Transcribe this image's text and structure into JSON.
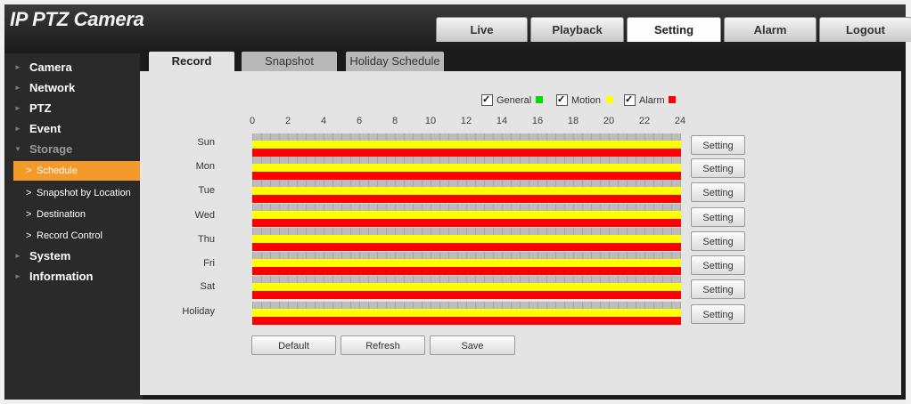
{
  "app": {
    "title": "IP PTZ Camera"
  },
  "top_tabs": [
    {
      "label": "Live"
    },
    {
      "label": "Playback"
    },
    {
      "label": "Setting",
      "active": true
    },
    {
      "label": "Alarm"
    },
    {
      "label": "Logout"
    }
  ],
  "sidebar": {
    "items": [
      {
        "label": "Camera"
      },
      {
        "label": "Network"
      },
      {
        "label": "PTZ"
      },
      {
        "label": "Event"
      },
      {
        "label": "Storage",
        "expanded": true
      },
      {
        "label": "System"
      },
      {
        "label": "Information"
      }
    ],
    "storage_subitems": [
      {
        "label": "Schedule",
        "active": true
      },
      {
        "label": "Snapshot by Location"
      },
      {
        "label": "Destination"
      },
      {
        "label": "Record Control"
      }
    ]
  },
  "sub_tabs": [
    {
      "label": "Record",
      "active": true
    },
    {
      "label": "Snapshot"
    },
    {
      "label": "Holiday Schedule"
    }
  ],
  "legend": [
    {
      "label": "General",
      "checked": true,
      "color": "#00dd00"
    },
    {
      "label": "Motion",
      "checked": true,
      "color": "#ffff00"
    },
    {
      "label": "Alarm",
      "checked": true,
      "color": "#ff0000"
    }
  ],
  "hours": [
    "0",
    "2",
    "4",
    "6",
    "8",
    "10",
    "12",
    "14",
    "16",
    "18",
    "20",
    "22",
    "24"
  ],
  "days": [
    {
      "label": "Sun",
      "button": "Setting"
    },
    {
      "label": "Mon",
      "button": "Setting"
    },
    {
      "label": "Tue",
      "button": "Setting"
    },
    {
      "label": "Wed",
      "button": "Setting"
    },
    {
      "label": "Thu",
      "button": "Setting"
    },
    {
      "label": "Fri",
      "button": "Setting"
    },
    {
      "label": "Sat",
      "button": "Setting"
    },
    {
      "label": "Holiday",
      "button": "Setting"
    }
  ],
  "actions": {
    "default": "Default",
    "refresh": "Refresh",
    "save": "Save"
  },
  "colors": {
    "accent": "#f39a2a",
    "general": "#bcbcbc",
    "motion": "#ffff00",
    "alarm": "#ff0000"
  }
}
